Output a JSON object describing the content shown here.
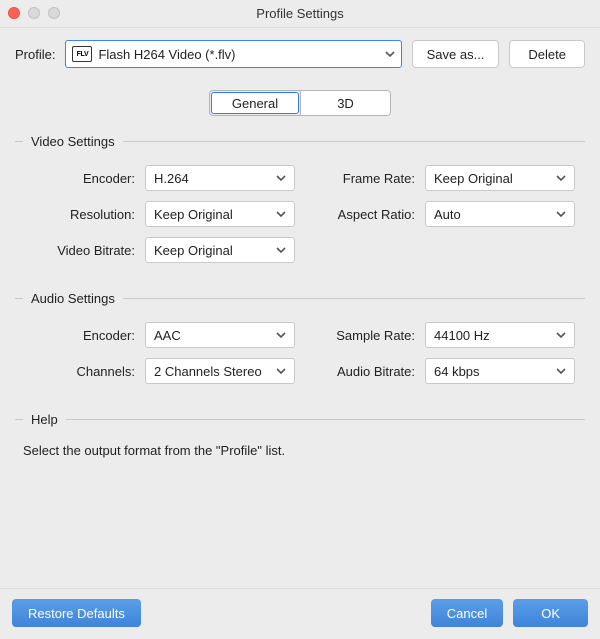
{
  "window": {
    "title": "Profile Settings"
  },
  "profile": {
    "label": "Profile:",
    "icon_text": "FLV",
    "selected": "Flash H264 Video (*.flv)",
    "save_as": "Save as...",
    "delete": "Delete"
  },
  "tabs": {
    "general": "General",
    "threeD": "3D"
  },
  "video": {
    "title": "Video Settings",
    "encoder_label": "Encoder:",
    "encoder_value": "H.264",
    "framerate_label": "Frame Rate:",
    "framerate_value": "Keep Original",
    "resolution_label": "Resolution:",
    "resolution_value": "Keep Original",
    "aspect_label": "Aspect Ratio:",
    "aspect_value": "Auto",
    "bitrate_label": "Video Bitrate:",
    "bitrate_value": "Keep Original"
  },
  "audio": {
    "title": "Audio Settings",
    "encoder_label": "Encoder:",
    "encoder_value": "AAC",
    "samplerate_label": "Sample Rate:",
    "samplerate_value": "44100 Hz",
    "channels_label": "Channels:",
    "channels_value": "2 Channels Stereo",
    "bitrate_label": "Audio Bitrate:",
    "bitrate_value": "64 kbps"
  },
  "help": {
    "title": "Help",
    "text": "Select the output format from the \"Profile\" list."
  },
  "buttons": {
    "restore": "Restore Defaults",
    "cancel": "Cancel",
    "ok": "OK"
  }
}
